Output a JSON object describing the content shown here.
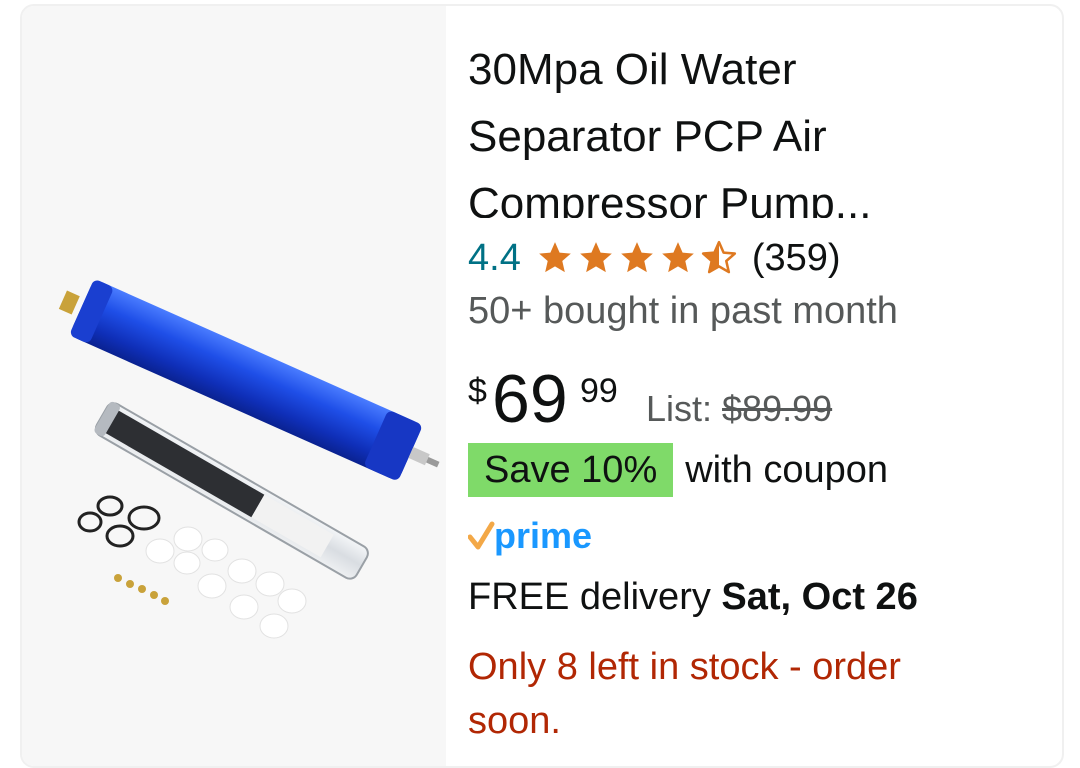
{
  "product": {
    "title": "30Mpa Oil Water Separator PCP Air Compressor Pump...",
    "rating": "4.4",
    "rating_value": 4.4,
    "review_count": "(359)",
    "bought": "50+ bought in past month",
    "price": {
      "symbol": "$",
      "whole": "69",
      "fraction": "99"
    },
    "list_price": {
      "label": "List: ",
      "value": "$89.99"
    },
    "coupon": {
      "badge": "Save 10%",
      "text": "with coupon"
    },
    "prime_label": "prime",
    "delivery": {
      "prefix": "FREE delivery ",
      "date": "Sat, Oct 26"
    },
    "stock": "Only 8 left in stock - order soon."
  },
  "colors": {
    "rating_link": "#007185",
    "star": "#de7921",
    "coupon_badge": "#7fda69",
    "prime_blue": "#1a98ff",
    "prime_check": "#f3a847",
    "stock_red": "#b12704"
  },
  "icons": {
    "star": "star-icon",
    "half_star": "half-star-icon",
    "prime_check": "check-icon"
  }
}
